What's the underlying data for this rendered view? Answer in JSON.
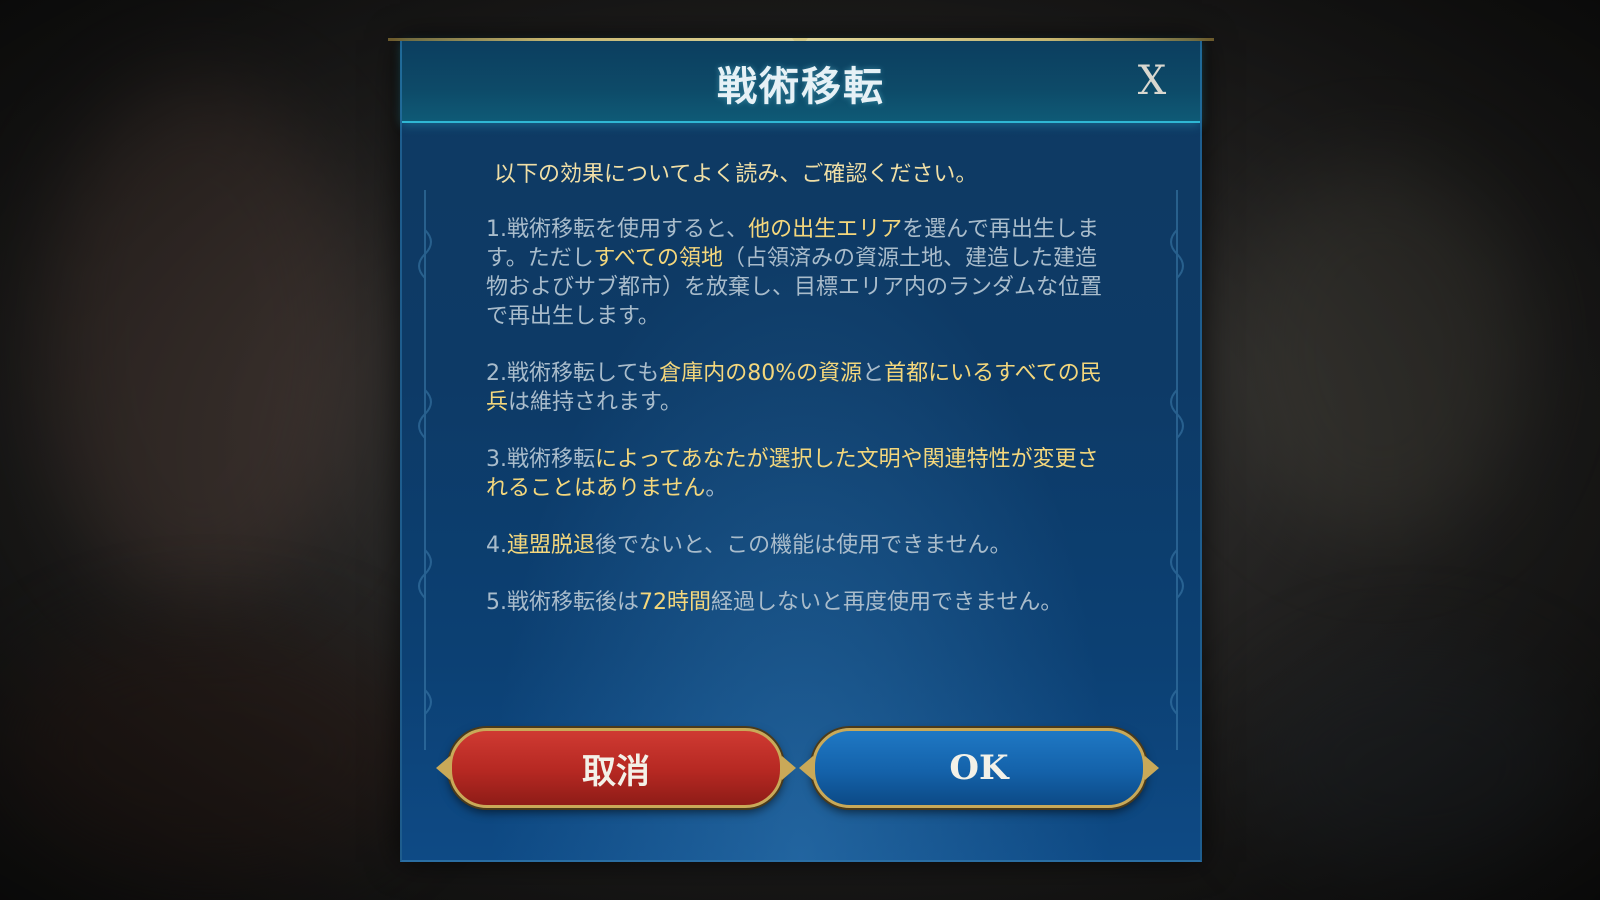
{
  "dialog": {
    "title": "戦術移転",
    "close_label": "X",
    "intro": "以下の効果についてよく読み、ご確認ください。",
    "paragraphs": [
      [
        {
          "text": "1.戦術移転を使用すると、",
          "hl": false
        },
        {
          "text": "他の出生エリア",
          "hl": true
        },
        {
          "text": "を選んで再出生します。ただし",
          "hl": false
        },
        {
          "text": "すべての領地",
          "hl": true
        },
        {
          "text": "（占領済みの資源土地、建造した建造物およびサブ都市）を放棄し、目標エリア内のランダムな位置で再出生します。",
          "hl": false
        }
      ],
      [
        {
          "text": "2.戦術移転しても",
          "hl": false
        },
        {
          "text": "倉庫内の80%の資源",
          "hl": true
        },
        {
          "text": "と",
          "hl": false
        },
        {
          "text": "首都にいるすべての民兵",
          "hl": true
        },
        {
          "text": "は維持されます。",
          "hl": false
        }
      ],
      [
        {
          "text": "3.戦術移転",
          "hl": false
        },
        {
          "text": "によってあなたが選択した文明や関連特性が変更されることはありません",
          "hl": true
        },
        {
          "text": "。",
          "hl": false
        }
      ],
      [
        {
          "text": "4.",
          "hl": false
        },
        {
          "text": "連盟脱退",
          "hl": true
        },
        {
          "text": "後でないと、この機能は使用できません。",
          "hl": false
        }
      ],
      [
        {
          "text": "5.戦術移転後は",
          "hl": false
        },
        {
          "text": "72時間",
          "hl": true
        },
        {
          "text": "経過しないと再度使用できません。",
          "hl": false
        }
      ]
    ],
    "buttons": {
      "cancel_label": "取消",
      "ok_label": "OK"
    }
  },
  "colors": {
    "highlight": "#f4d77c",
    "body_text": "#a9bccb",
    "cancel_button": "#b52822",
    "ok_button": "#1462aa",
    "gold_trim": "#c9a958"
  },
  "icons": {
    "close": "close-icon"
  }
}
